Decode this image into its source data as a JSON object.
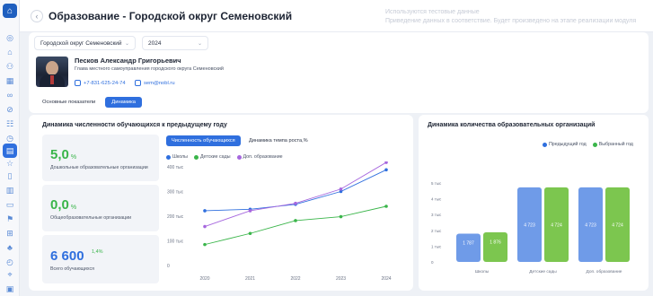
{
  "header": {
    "title": "Образование - Городской округ Семеновский",
    "demo_note_line1": "Используются тестовые данные",
    "demo_note_line2": "Приведение данных в соответствие. Будет произведено на этапе реализации модуля"
  },
  "filters": {
    "district": "Городской округ Семеновский",
    "year": "2024"
  },
  "person": {
    "name": "Песков Александр Григорьевич",
    "role": "Глава местного самоуправления городского округа Семеновский",
    "phone": "+7-831-625-24-74",
    "email": "sem@nobl.ru"
  },
  "main_tabs": [
    {
      "label": "Основные показатели",
      "active": false
    },
    {
      "label": "Динамика",
      "active": true
    }
  ],
  "colors": {
    "accent": "#2f6fde",
    "green": "#3ab54a",
    "purple": "#a667de",
    "bar_blue": "#6f9be8",
    "bar_green": "#7cc64f"
  },
  "students_card": {
    "title": "Динамика численности обучающихся к предыдущему году",
    "kpis": [
      {
        "value": "5,0",
        "unit": "%",
        "superscript": "",
        "label": "Дошкольные образовательные организации",
        "color": "green"
      },
      {
        "value": "0,0",
        "unit": "%",
        "superscript": "",
        "label": "Общеобразовательные организации",
        "color": "green"
      },
      {
        "value": "6 600",
        "unit": "",
        "superscript": "1,4%",
        "label": "Всего обучающихся",
        "color": "blue"
      }
    ],
    "chips": [
      {
        "label": "Численность обучающихся",
        "active": true
      },
      {
        "label": "Динамика темпа роста,%",
        "active": false
      }
    ]
  },
  "orgs_card": {
    "title": "Динамика количества образовательных организаций"
  },
  "chart_data": [
    {
      "type": "line",
      "title": "",
      "x": [
        "2020",
        "2021",
        "2022",
        "2023",
        "2024"
      ],
      "y_ticks": [
        "0",
        "100 тыс",
        "200 тыс",
        "300 тыс",
        "400 тыс"
      ],
      "ylim": [
        0,
        400
      ],
      "grid": false,
      "legend": "top-left",
      "series": [
        {
          "name": "Школы",
          "color": "#2f6fde",
          "values": [
            222,
            228,
            248,
            300,
            388
          ]
        },
        {
          "name": "Детские сады",
          "color": "#3ab54a",
          "values": [
            85,
            130,
            182,
            198,
            240
          ]
        },
        {
          "name": "Доп. образование",
          "color": "#a667de",
          "values": [
            158,
            222,
            252,
            310,
            418
          ]
        }
      ]
    },
    {
      "type": "bar",
      "title": "",
      "categories": [
        "Школы",
        "Детские сады",
        "Доп. образование"
      ],
      "y_ticks": [
        "0",
        "1 тыс",
        "2 тыс",
        "3 тыс",
        "4 тыс",
        "5 тыс"
      ],
      "ylim": [
        0,
        5000
      ],
      "grid": false,
      "legend": "top-right",
      "series": [
        {
          "name": "Предыдущий год",
          "color": "#6f9be8",
          "values": [
            1787,
            4723,
            4723
          ],
          "labels": [
            "1 787",
            "4 723",
            "4 723"
          ]
        },
        {
          "name": "Выбранный год",
          "color": "#7cc64f",
          "values": [
            1876,
            4724,
            4724
          ],
          "labels": [
            "1 876",
            "4 724",
            "4 724"
          ]
        }
      ]
    }
  ],
  "sidebar_icons": [
    "home-icon",
    "bank-icon",
    "users-icon",
    "chart-icon",
    "link-icon",
    "clip-icon",
    "people-icon",
    "clock-icon",
    "book-icon",
    "star-icon",
    "file-icon",
    "building-icon",
    "layers-icon",
    "flag-icon",
    "city-icon",
    "tree-icon",
    "timer-icon",
    "compass-icon",
    "calendar-icon"
  ]
}
